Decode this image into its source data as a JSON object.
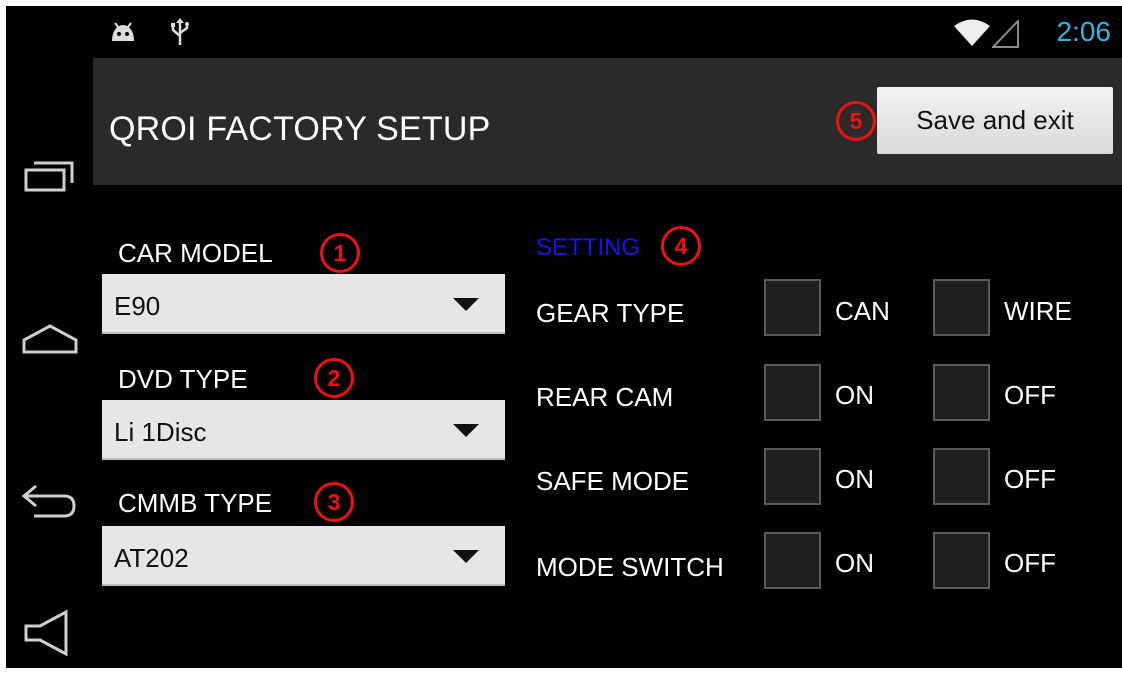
{
  "status_bar": {
    "time": "2:06",
    "icons": [
      "android-debug-icon",
      "usb-icon",
      "wifi-icon",
      "signal-icon"
    ]
  },
  "nav_bar": {
    "buttons": [
      "recent-apps-icon",
      "home-icon",
      "back-icon",
      "volume-icon"
    ]
  },
  "action_bar": {
    "title": "QROI FACTORY SETUP",
    "save_label": "Save and exit",
    "badge": "5"
  },
  "fields": [
    {
      "label": "CAR MODEL",
      "value": "E90",
      "badge": "1"
    },
    {
      "label": "DVD TYPE",
      "value": "Li 1Disc",
      "badge": "2"
    },
    {
      "label": "CMMB TYPE",
      "value": "AT202",
      "badge": "3"
    }
  ],
  "setting": {
    "title": "SETTING",
    "badge": "4",
    "rows": [
      {
        "label": "GEAR TYPE",
        "options": [
          "CAN",
          "WIRE"
        ]
      },
      {
        "label": "REAR CAM",
        "options": [
          "ON",
          "OFF"
        ]
      },
      {
        "label": "SAFE MODE",
        "options": [
          "ON",
          "OFF"
        ]
      },
      {
        "label": "MODE SWITCH",
        "options": [
          "ON",
          "OFF"
        ]
      }
    ]
  },
  "colors": {
    "accent": "#33b5e5",
    "badge_red": "#ee1111",
    "setting_title": "#1515ee",
    "action_bar": "#2a2a2a"
  }
}
